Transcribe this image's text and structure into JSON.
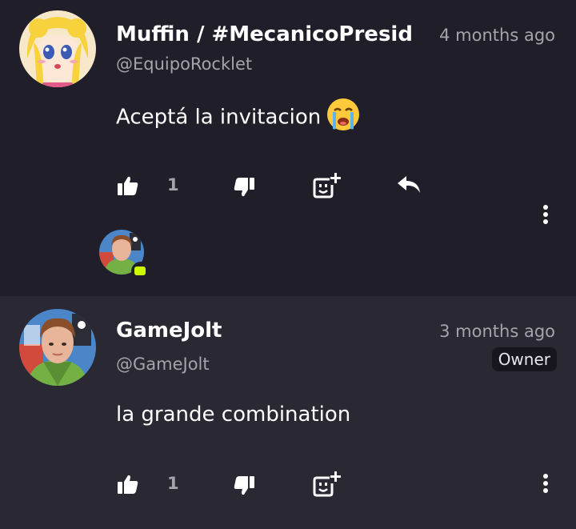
{
  "comments": [
    {
      "author_name": "Muffin / #MecanicoPresidente",
      "author_handle": "@EquipoRocklet",
      "time": "4 months ago",
      "text": "Aceptá la invitacion",
      "text_emoji": "loudly-crying-face-emoji",
      "likes": "1",
      "actions": [
        "like-icon",
        "dislike-icon",
        "add-reaction-icon",
        "reply-icon",
        "more-options-icon"
      ],
      "has_reply": true
    },
    {
      "author_name": "GameJolt",
      "author_handle": "@GameJolt",
      "time": "3 months ago",
      "badge": "Owner",
      "text": "la grande combination",
      "likes": "1",
      "actions": [
        "like-icon",
        "dislike-icon",
        "add-reaction-icon",
        "more-options-icon"
      ]
    }
  ],
  "colors": {
    "background": "#201f29",
    "highlighted_background": "#292833",
    "muted_text": "#a5a4ad",
    "accent": "#ccff00"
  }
}
